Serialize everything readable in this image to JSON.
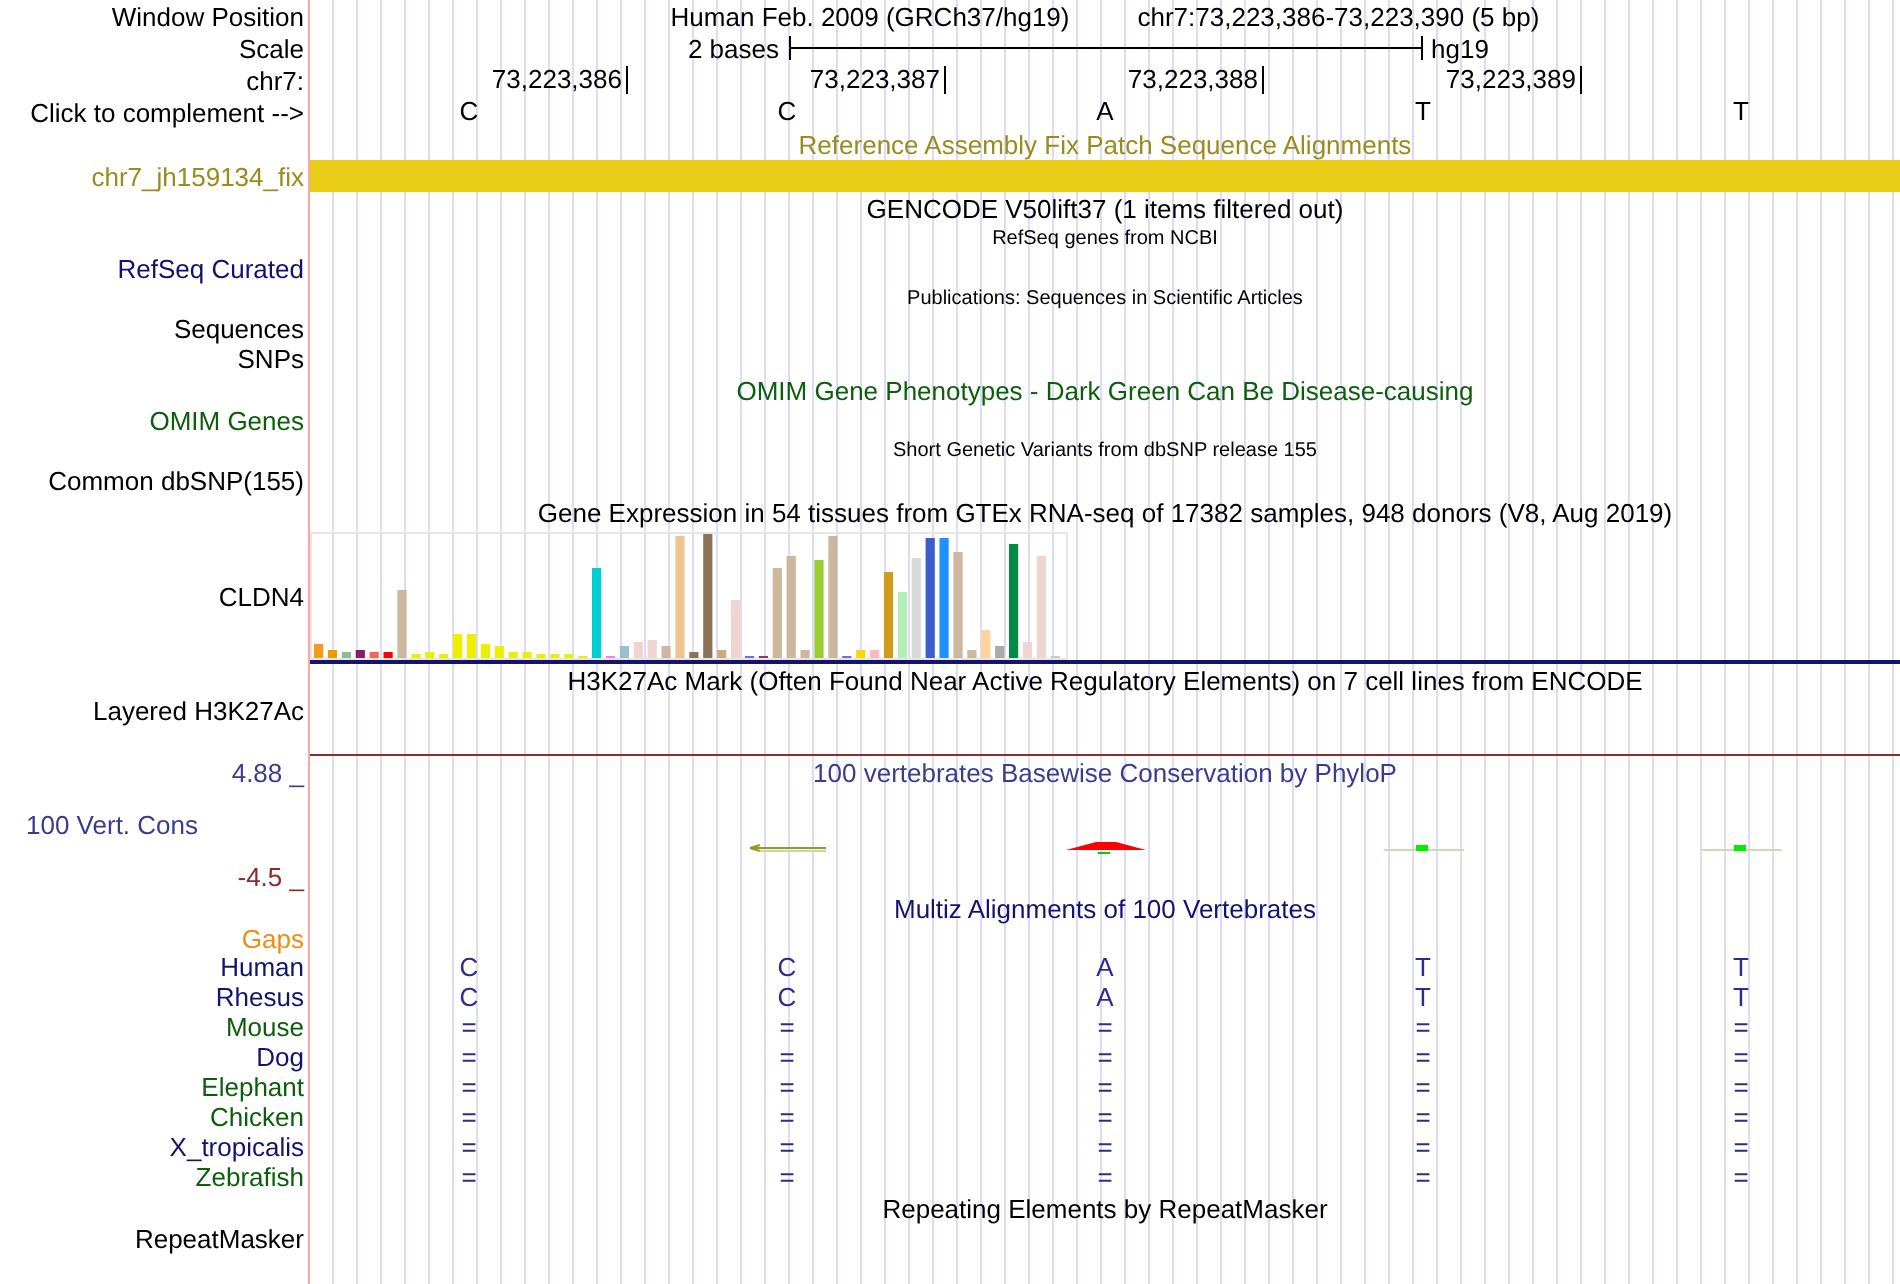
{
  "header": {
    "position_label": "Window Position",
    "assembly": "Human Feb. 2009 (GRCh37/hg19)",
    "position": "chr7:73,223,386-73,223,390 (5 bp)",
    "scale_label": "Scale",
    "scale": "2 bases",
    "scale_db": "hg19",
    "chrom_label": "chr7:",
    "ticks": [
      "73,223,386",
      "73,223,387",
      "73,223,388",
      "73,223,389"
    ],
    "complement_label": "Click to complement -->",
    "bases": [
      "C",
      "C",
      "A",
      "T",
      "T"
    ]
  },
  "rows": [
    {
      "kind": "title",
      "text": "Reference Assembly Fix Patch Sequence Alignments",
      "color": "#9a8b1c"
    },
    {
      "kind": "bar",
      "label": "chr7_jh159134_fix",
      "color": "#9a8b1c"
    },
    {
      "kind": "title",
      "text": "GENCODE V50lift37 (1 items filtered out)",
      "color": "#000000"
    },
    {
      "kind": "subtitle",
      "text": "RefSeq genes from NCBI"
    },
    {
      "kind": "label",
      "label": "RefSeq Curated",
      "color": "#12126e"
    },
    {
      "kind": "subtitle",
      "text": "Publications: Sequences in Scientific Articles"
    },
    {
      "kind": "label",
      "label": "Sequences",
      "color": "#000000"
    },
    {
      "kind": "label",
      "label": "SNPs",
      "color": "#000000"
    },
    {
      "kind": "title",
      "text": "OMIM Gene Phenotypes - Dark Green Can Be Disease-causing",
      "color": "#0c5e0c"
    },
    {
      "kind": "label",
      "label": "OMIM Genes",
      "color": "#0c5e0c"
    },
    {
      "kind": "subtitle",
      "text": "Short Genetic Variants from dbSNP release 155"
    },
    {
      "kind": "label",
      "label": "Common dbSNP(155)",
      "color": "#000000"
    },
    {
      "kind": "title",
      "text": "Gene Expression in 54 tissues from GTEx RNA-seq of 17382 samples, 948 donors (V8, Aug 2019)",
      "color": "#000000"
    },
    {
      "kind": "expression",
      "label": "CLDN4"
    },
    {
      "kind": "title",
      "text": "H3K27Ac Mark (Often Found Near Active Regulatory Elements) on 7 cell lines from ENCODE",
      "color": "#000000"
    },
    {
      "kind": "signal",
      "label": "Layered H3K27Ac"
    },
    {
      "kind": "phylop",
      "title": "100 vertebrates Basewise Conservation by PhyloP",
      "label": "100 Vert. Cons",
      "max": "4.88 _",
      "min": "-4.5 _",
      "color": "#3c3c8c"
    },
    {
      "kind": "title",
      "text": "Multiz Alignments of 100 Vertebrates",
      "color": "#14146e"
    },
    {
      "kind": "gaps",
      "label": "Gaps",
      "color": "#f08c14"
    },
    {
      "kind": "species",
      "label": "Human",
      "bases": [
        "C",
        "C",
        "A",
        "T",
        "T"
      ],
      "color": "#14146e"
    },
    {
      "kind": "species",
      "label": "Rhesus",
      "bases": [
        "C",
        "C",
        "A",
        "T",
        "T"
      ],
      "color": "#14146e"
    },
    {
      "kind": "species",
      "label": "Mouse",
      "bases": [
        "=",
        "=",
        "=",
        "=",
        "="
      ],
      "color": "#0c5e0c"
    },
    {
      "kind": "species",
      "label": "Dog",
      "bases": [
        "=",
        "=",
        "=",
        "=",
        "="
      ],
      "color": "#14146e"
    },
    {
      "kind": "species",
      "label": "Elephant",
      "bases": [
        "=",
        "=",
        "=",
        "=",
        "="
      ],
      "color": "#0c5e0c"
    },
    {
      "kind": "species",
      "label": "Chicken",
      "bases": [
        "=",
        "=",
        "=",
        "=",
        "="
      ],
      "color": "#0c5e0c"
    },
    {
      "kind": "species",
      "label": "X_tropicalis",
      "bases": [
        "=",
        "=",
        "=",
        "=",
        "="
      ],
      "color": "#14146e"
    },
    {
      "kind": "species",
      "label": "Zebrafish",
      "bases": [
        "=",
        "=",
        "=",
        "=",
        "="
      ],
      "color": "#0c5e0c"
    },
    {
      "kind": "title",
      "text": "Repeating Elements by RepeatMasker",
      "color": "#000000"
    },
    {
      "kind": "label",
      "label": "RepeatMasker",
      "color": "#000000"
    }
  ]
}
